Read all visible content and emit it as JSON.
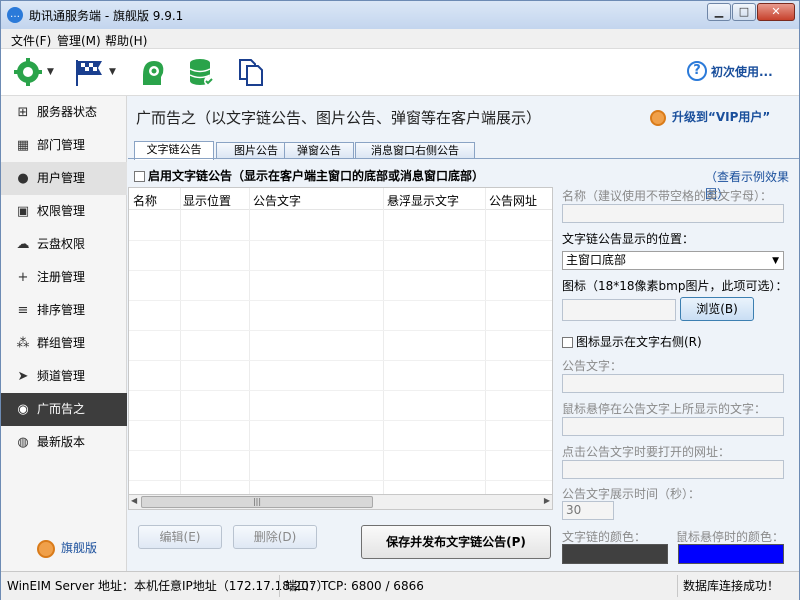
{
  "window": {
    "title": "助讯通服务端 - 旗舰版  9.9.1"
  },
  "menu": [
    "文件(F)",
    "管理(M)",
    "帮助(H)"
  ],
  "toolbar": {
    "help_label": "初次使用..."
  },
  "sidebar": {
    "items": [
      {
        "label": "服务器状态",
        "icon": "server-icon"
      },
      {
        "label": "部门管理",
        "icon": "grid-icon"
      },
      {
        "label": "用户管理",
        "icon": "user-icon"
      },
      {
        "label": "权限管理",
        "icon": "lock-icon"
      },
      {
        "label": "云盘权限",
        "icon": "cloud-icon"
      },
      {
        "label": "注册管理",
        "icon": "plus-icon"
      },
      {
        "label": "排序管理",
        "icon": "sort-icon"
      },
      {
        "label": "群组管理",
        "icon": "group-icon"
      },
      {
        "label": "频道管理",
        "icon": "pointer-icon"
      },
      {
        "label": "广而告之",
        "icon": "pin-icon"
      },
      {
        "label": "最新版本",
        "icon": "chat-icon"
      }
    ],
    "active_index": 9,
    "edition": "旗舰版"
  },
  "main": {
    "heading": "广而告之（以文字链公告、图片公告、弹窗等在客户端展示）",
    "upgrade": "升级到“VIP用户”",
    "tabs": [
      "文字链公告",
      "图片公告",
      "弹窗公告",
      "消息窗口右侧公告"
    ],
    "active_tab": 0,
    "enable_label": "启用文字链公告（显示在客户端主窗口的底部或消息窗口底部）",
    "demo_link": "（查看示例效果图）",
    "columns": [
      "名称",
      "显示位置",
      "公告文字",
      "悬浮显示文字",
      "公告网址"
    ],
    "buttons": {
      "edit": "编辑(E)",
      "delete": "删除(D)",
      "save": "保存并发布文字链公告(P)"
    }
  },
  "form": {
    "name_label": "名称（建议使用不带空格的英文字母）：",
    "position_label": "文字链公告显示的位置：",
    "position_value": "主窗口底部",
    "icon_label": "图标（18*18像素bmp图片，此项可选）：",
    "browse": "浏览(B)",
    "icon_right_label": "图标显示在文字右侧(R)",
    "text_label": "公告文字：",
    "hover_label": "鼠标悬停在公告文字上所显示的文字：",
    "url_label": "点击公告文字时要打开的网址：",
    "duration_label": "公告文字展示时间（秒）：",
    "duration_value": "30",
    "text_color_label": "文字链的颜色：",
    "hover_color_label": "鼠标悬停时的颜色：",
    "text_color": "#404040",
    "hover_color": "#0000ff"
  },
  "status": {
    "server": "WinEIM Server 地址：本机任意IP地址（172.17.18.207）",
    "port": "端口：TCP: 6800 / 6866",
    "db": "数据库连接成功！"
  }
}
